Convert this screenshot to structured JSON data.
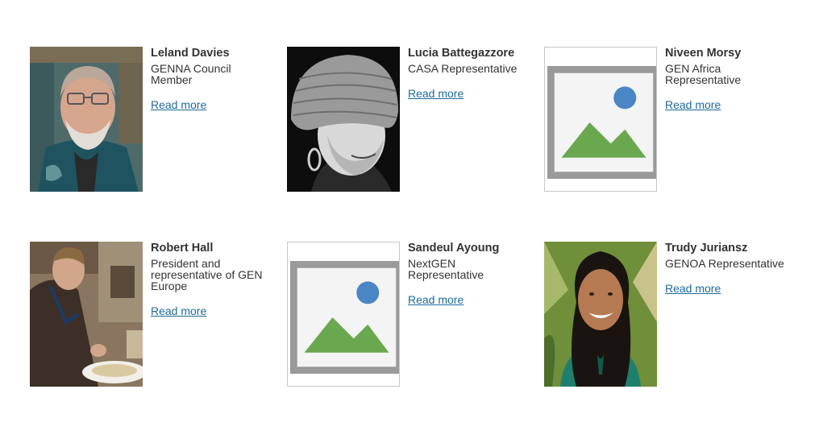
{
  "people": [
    {
      "name": "Leland Davies",
      "role": "GENNA Council Member",
      "link": "Read more",
      "photo": "portrait-man-glasses"
    },
    {
      "name": "Lucia Battegazzore",
      "role": "CASA Representative",
      "link": "Read more",
      "photo": "portrait-woman-knit-hat"
    },
    {
      "name": "Niveen Morsy",
      "role": "GEN Africa Representative",
      "link": "Read more",
      "photo": "broken-image"
    },
    {
      "name": "Robert Hall",
      "role": "President and representative of GEN Europe",
      "link": "Read more",
      "photo": "portrait-man-eating"
    },
    {
      "name": "Sandeul Ayoung",
      "role": "NextGEN Representative",
      "link": "Read more",
      "photo": "broken-image"
    },
    {
      "name": "Trudy Juriansz",
      "role": "GENOA Representative",
      "link": "Read more",
      "photo": "portrait-woman-smiling"
    }
  ],
  "colors": {
    "link": "#1d6b9c",
    "text": "#333333",
    "broken_border": "#c8c8c8"
  }
}
